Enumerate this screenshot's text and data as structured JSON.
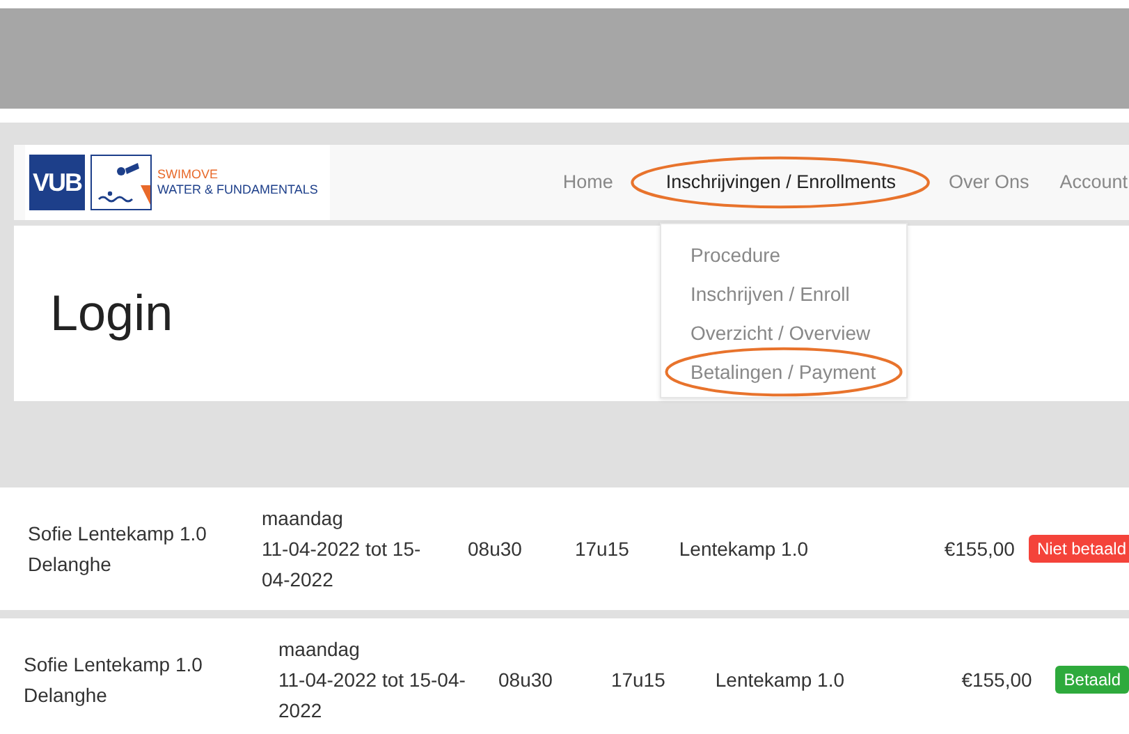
{
  "logo": {
    "mark": "VUB",
    "line1": "SWIMOVE",
    "line2": "WATER & FUNDAMENTALS"
  },
  "nav": [
    {
      "label": "Home",
      "highlighted": false
    },
    {
      "label": "Inschrijvingen / Enrollments",
      "highlighted": true
    },
    {
      "label": "Over Ons",
      "highlighted": false
    },
    {
      "label": "Account",
      "highlighted": false
    }
  ],
  "dropdown": [
    {
      "label": "Procedure",
      "highlighted": false
    },
    {
      "label": "Inschrijven / Enroll",
      "highlighted": false
    },
    {
      "label": "Overzicht / Overview",
      "highlighted": false
    },
    {
      "label": "Betalingen / Payment",
      "highlighted": true
    }
  ],
  "page_title": "Login",
  "rows": [
    {
      "name": "Sofie Lentekamp 1.0 Delanghe",
      "day": "maandag",
      "dates": "11-04-2022 tot 15-04-2022",
      "start": "08u30",
      "end": "17u15",
      "camp": "Lentekamp 1.0",
      "price": "€155,00",
      "status": {
        "label": "Niet betaald",
        "color": "#f4433a"
      }
    },
    {
      "name": "Sofie Lentekamp 1.0 Delanghe",
      "day": "maandag",
      "dates": "11-04-2022 tot 15-04-2022",
      "start": "08u30",
      "end": "17u15",
      "camp": "Lentekamp 1.0",
      "price": "€155,00",
      "status": {
        "label": "Betaald",
        "color": "#2eaa3c"
      }
    }
  ]
}
